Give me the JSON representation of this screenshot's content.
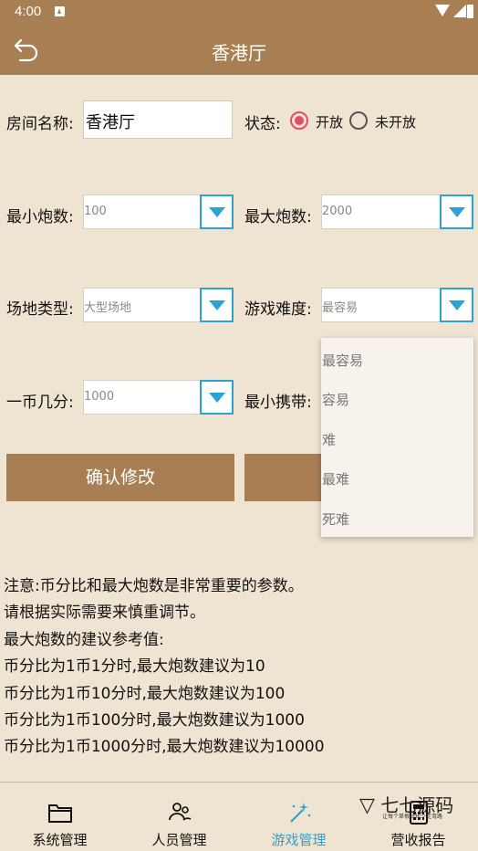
{
  "statusbar": {
    "time": "4:00"
  },
  "header": {
    "title": "香港厅"
  },
  "form": {
    "room_name_label": "房间名称:",
    "room_name_value": "香港厅",
    "status_label": "状态:",
    "status_open": "开放",
    "status_closed": "未开放",
    "status_selected": "开放",
    "min_cannon_label": "最小炮数:",
    "min_cannon_value": "100",
    "max_cannon_label": "最大炮数:",
    "max_cannon_value": "2000",
    "venue_type_label": "场地类型:",
    "venue_type_value": "大型场地",
    "difficulty_label": "游戏难度:",
    "difficulty_value": "最容易",
    "coin_ratio_label": "一币几分:",
    "coin_ratio_value": "1000",
    "min_carry_label": "最小携带:",
    "confirm_button": "确认修改"
  },
  "difficulty_dropdown": {
    "options": [
      "最容易",
      "容易",
      "难",
      "最难",
      "死难"
    ]
  },
  "notes": [
    "注意:币分比和最大炮数是非常重要的参数。",
    " 请根据实际需要来慎重调节。",
    " 最大炮数的建议参考值:",
    " 币分比为1币1分时,最大炮数建议为10",
    " 币分比为1币10分时,最大炮数建议为100",
    " 币分比为1币100分时,最大炮数建议为1000",
    " 币分比为1币1000分时,最大炮数建议为10000"
  ],
  "tabs": [
    {
      "label": "系统管理",
      "icon": "folder-icon"
    },
    {
      "label": "人员管理",
      "icon": "people-icon"
    },
    {
      "label": "游戏管理",
      "icon": "magic-wand-icon",
      "active": true
    },
    {
      "label": "营收报告",
      "icon": "calculator-icon"
    }
  ],
  "watermark": {
    "text": "七七源码",
    "sub": "让每个草根站长少走弯路"
  },
  "colors": {
    "brown": "#a87e53",
    "background": "#efe3d1",
    "accent_blue": "#2aa3d6",
    "radio_pink": "#e8486a"
  }
}
